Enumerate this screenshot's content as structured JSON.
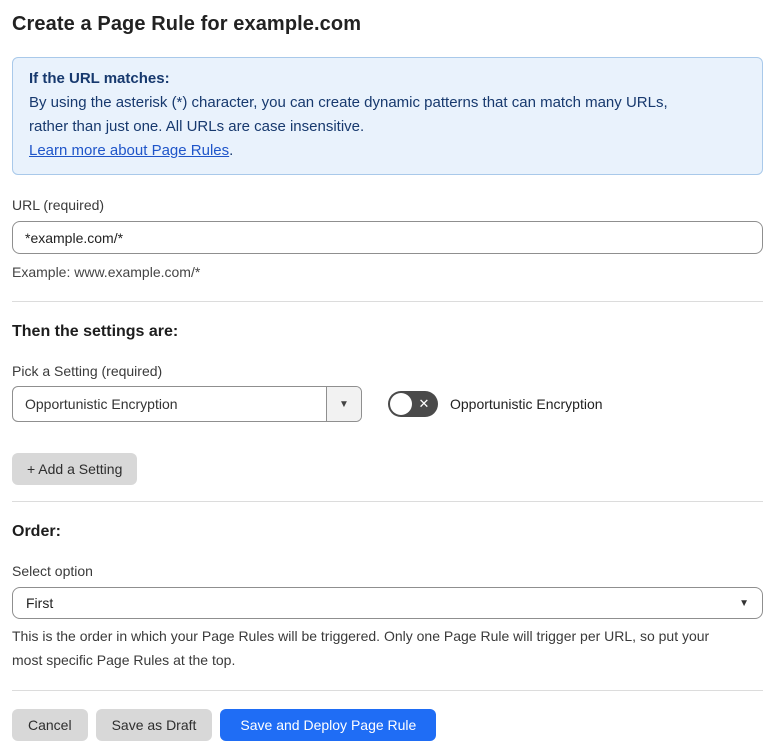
{
  "page": {
    "title": "Create a Page Rule for example.com"
  },
  "info_box": {
    "heading": "If the URL matches:",
    "body_line1": "By using the asterisk (*) character, you can create dynamic patterns that can match many URLs,",
    "body_line2": "rather than just one. All URLs are case insensitive.",
    "link_label": "Learn more about Page Rules",
    "link_suffix": "."
  },
  "url_field": {
    "label": "URL (required)",
    "value": "*example.com/*",
    "helper": "Example: www.example.com/*"
  },
  "settings_section": {
    "heading": "Then the settings are:",
    "pick_label": "Pick a Setting (required)",
    "selected_setting": "Opportunistic Encryption",
    "toggle_state": "off",
    "toggle_off_glyph": "✕",
    "toggle_label": "Opportunistic Encryption",
    "add_button_label": "+ Add a Setting"
  },
  "order_section": {
    "heading": "Order:",
    "select_label": "Select option",
    "selected_option": "First",
    "helper_line1": "This is the order in which your Page Rules will be triggered. Only one Page Rule will trigger per URL, so put your",
    "helper_line2": "most specific Page Rules at the top."
  },
  "footer": {
    "cancel_label": "Cancel",
    "save_draft_label": "Save as Draft",
    "save_deploy_label": "Save and Deploy Page Rule"
  },
  "icons": {
    "caret_down": "▼"
  },
  "colors": {
    "info_bg": "#e9f2fc",
    "info_border": "#a9c9ea",
    "info_text": "#17396e",
    "link_blue": "#1f55c9",
    "primary_button_blue": "#1f6df5",
    "gray_button": "#d8d8d8",
    "toggle_off_bg": "#4a4a4a"
  }
}
